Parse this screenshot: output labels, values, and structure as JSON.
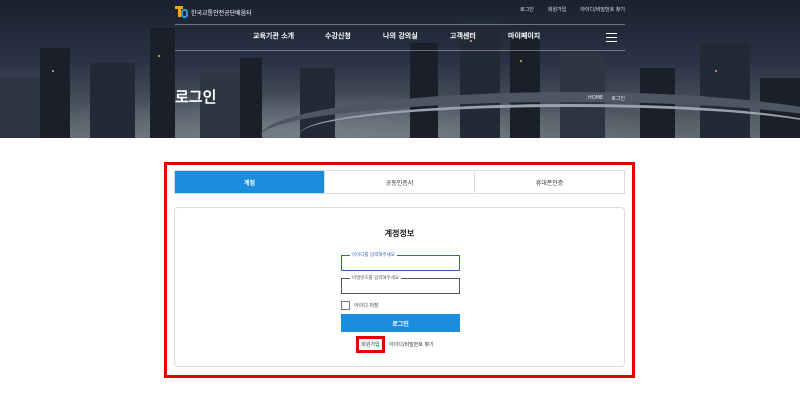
{
  "header": {
    "logo_text": "한국교통안전공단배움터",
    "utility": [
      "로그인",
      "회원가입",
      "아이디/비밀번호 찾기"
    ],
    "nav": [
      "교육기관 소개",
      "수강신청",
      "나의 강의실",
      "고객센터",
      "마이페이지"
    ],
    "page_title": "로그인",
    "breadcrumb": [
      "HOME",
      "로그인"
    ]
  },
  "login": {
    "tabs": [
      "계정",
      "공동인증서",
      "휴대폰인증"
    ],
    "active_tab": 0,
    "section_title": "계정정보",
    "id_placeholder": "아이디를 입력해주세요",
    "pw_placeholder": "비밀번호를 입력해주세요",
    "remember_label": "아이디 저장",
    "login_button": "로그인",
    "signup_link": "회원가입",
    "find_link": "아이디/비밀번호 찾기"
  },
  "colors": {
    "accent": "#1b8dde",
    "highlight": "#e50000"
  }
}
